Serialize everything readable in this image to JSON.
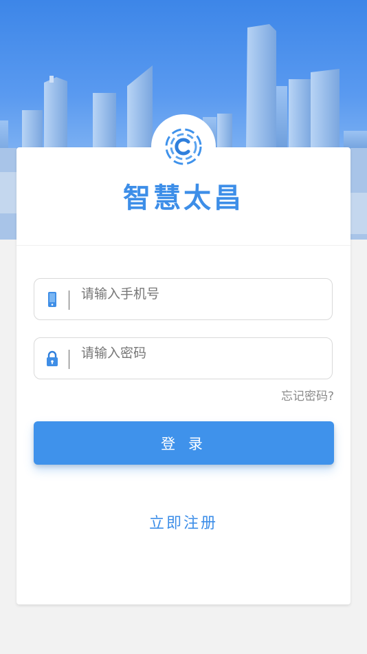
{
  "app": {
    "title": "智慧太昌"
  },
  "form": {
    "phone_placeholder": "请输入手机号",
    "password_placeholder": "请输入密码",
    "phone_value": "",
    "password_value": "",
    "forgot_label": "忘记密码?",
    "login_label": "登 录",
    "register_label": "立即注册"
  },
  "icons": {
    "logo": "app-logo-icon",
    "phone": "phone-icon",
    "lock": "lock-icon"
  },
  "colors": {
    "accent": "#3f92eb",
    "title": "#3d8ee8",
    "background": "#f2f2f2",
    "banner_sky": "#3d86e8"
  }
}
